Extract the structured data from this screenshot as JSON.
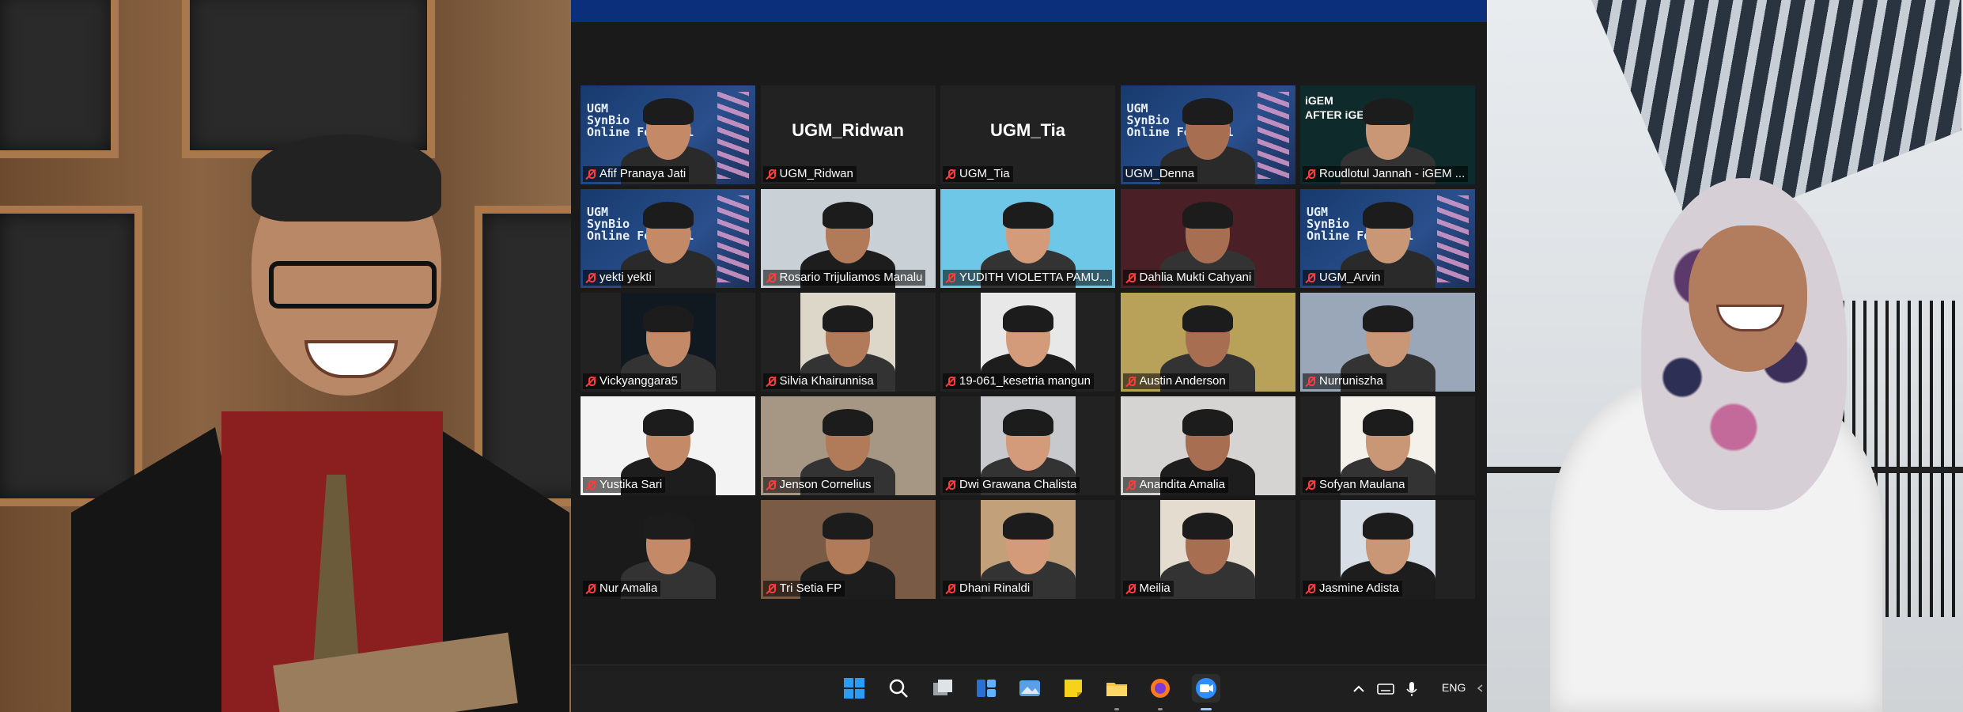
{
  "window": {
    "title": ""
  },
  "tiles": [
    {
      "kind": "poster",
      "name": "Afif Pranaya Jati",
      "poster_text": "UGM\nSynBio\nOnline Festival",
      "muted": true
    },
    {
      "kind": "name",
      "name": "UGM_Ridwan",
      "big": "UGM_Ridwan",
      "muted": true
    },
    {
      "kind": "name",
      "name": "UGM_Tia",
      "big": "UGM_Tia",
      "muted": true
    },
    {
      "kind": "poster",
      "name": "UGM_Denna",
      "poster_text": "UGM\nSynBio\nOnline Festival",
      "muted": false,
      "active": true
    },
    {
      "kind": "video",
      "name": "Roudlotul Jannah - iGEM ...",
      "muted": true,
      "bg": "#0e2a2a",
      "overlay": "iGEM\nAFTER iGEM"
    },
    {
      "kind": "poster",
      "name": "yekti yekti",
      "poster_text": "UGM\nSynBio\nOnline Festival",
      "muted": true
    },
    {
      "kind": "video",
      "name": "Rosario Trijuliamos Manalu",
      "muted": true,
      "bg": "#c9d0d6"
    },
    {
      "kind": "video",
      "name": "YUDITH VIOLETTA PAMU...",
      "muted": true,
      "bg": "#6fc7e8"
    },
    {
      "kind": "video",
      "name": "Dahlia Mukti Cahyani",
      "muted": true,
      "bg": "#4a1f25"
    },
    {
      "kind": "poster",
      "name": "UGM_Arvin",
      "poster_text": "UGM\nSynBio\nOnline Festival",
      "muted": true
    },
    {
      "kind": "video",
      "name": "Vickyanggara5",
      "muted": true,
      "bg": "#101820",
      "narrow": true
    },
    {
      "kind": "video",
      "name": "Silvia Khairunnisa",
      "muted": true,
      "bg": "#dcd7c8",
      "narrow": true
    },
    {
      "kind": "video",
      "name": "19-061_kesetria mangun",
      "muted": true,
      "bg": "#e8e8e8",
      "narrow": true
    },
    {
      "kind": "video",
      "name": "Austin Anderson",
      "muted": true,
      "bg": "#b8a25a"
    },
    {
      "kind": "video",
      "name": "Nurruniszha",
      "muted": true,
      "bg": "#9aa7b8"
    },
    {
      "kind": "video",
      "name": "Yustika Sari",
      "muted": true,
      "bg": "#f3f3f3"
    },
    {
      "kind": "video",
      "name": "Jenson Cornelius",
      "muted": true,
      "bg": "#a69684"
    },
    {
      "kind": "video",
      "name": "Dwi Grawana Chalista",
      "muted": true,
      "bg": "#c7c9cc",
      "narrow": true
    },
    {
      "kind": "video",
      "name": "Anandita Amalia",
      "muted": true,
      "bg": "#d6d4d2"
    },
    {
      "kind": "video",
      "name": "Sofyan Maulana",
      "muted": true,
      "bg": "#f4f1ea",
      "narrow": true
    },
    {
      "kind": "video",
      "name": "Nur Amalia",
      "muted": true,
      "bg": "#1a1a1a"
    },
    {
      "kind": "video",
      "name": "Tri Setia FP",
      "muted": true,
      "bg": "#7a5b45"
    },
    {
      "kind": "video",
      "name": "Dhani Rinaldi",
      "muted": true,
      "bg": "#c2a07a",
      "narrow": true
    },
    {
      "kind": "video",
      "name": "Meilia",
      "muted": true,
      "bg": "#e3dccf",
      "narrow": true
    },
    {
      "kind": "video",
      "name": "Jasmine Adista",
      "muted": true,
      "bg": "#d8dee6",
      "narrow": true
    }
  ],
  "taskbar": {
    "icons": [
      "windows-start-icon",
      "search-icon",
      "task-view-icon",
      "widgets-icon",
      "photos-icon",
      "sticky-notes-icon",
      "file-explorer-icon",
      "firefox-icon",
      "zoom-icon"
    ],
    "tray": {
      "language": "ENG"
    }
  },
  "colors": {
    "zoom_blue": "#0b2f7a",
    "active_speaker": "#d9e35b",
    "muted_mic": "#ff3b3b"
  }
}
